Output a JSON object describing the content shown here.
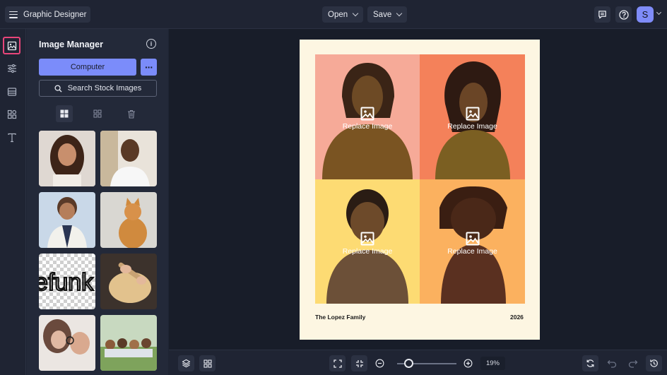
{
  "topbar": {
    "app_title": "Graphic Designer",
    "open_label": "Open",
    "save_label": "Save",
    "avatar_initial": "S"
  },
  "rail": {
    "items": [
      "image-icon",
      "sliders-icon",
      "layout-icon",
      "shapes-icon",
      "text-icon"
    ]
  },
  "panel": {
    "title": "Image Manager",
    "computer_label": "Computer",
    "stock_label": "Search Stock Images",
    "thumbnails": [
      "woman-curly-hair",
      "smiling-man",
      "boy-in-vest",
      "orange-cat",
      "efunk-transparent-text",
      "rolling-dough",
      "woman-with-glasses",
      "group-in-grass"
    ],
    "thumbnail_text": "efunk"
  },
  "canvas": {
    "replace_label": "Replace Image",
    "family_name": "The Lopez Family",
    "year": "2026",
    "colors": {
      "top_left": "#f6aa98",
      "top_right": "#f4815a",
      "bottom_left": "#fddb73",
      "bottom_right": "#fbb15f"
    }
  },
  "bottombar": {
    "zoom": "19%",
    "zoom_level": 0.19
  },
  "accent": "#7b8cfa",
  "highlight": "#e8457a"
}
